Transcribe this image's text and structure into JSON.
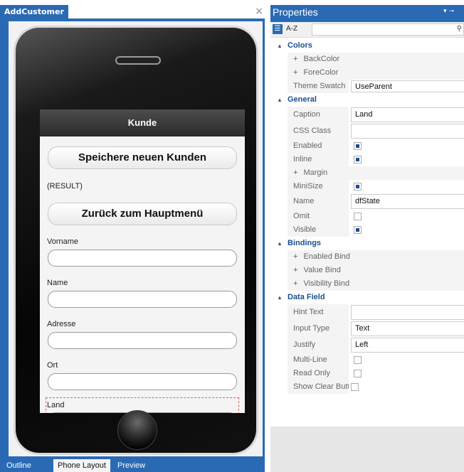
{
  "document_tab": {
    "title": "AddCustomer",
    "close": "×"
  },
  "phone_screen": {
    "header_title": "Kunde",
    "save_button": "Speichere neuen Kunden",
    "result_label": "(RESULT)",
    "back_button": "Zurück zum Hauptmenü",
    "fields": {
      "vorname": "Vorname",
      "name": "Name",
      "adresse": "Adresse",
      "ort": "Ort",
      "land": "Land"
    }
  },
  "bottom_tabs": [
    "Outline",
    "Phone Layout",
    "Preview"
  ],
  "properties": {
    "title": "Properties",
    "pin": "▾ ⊸",
    "sort_az": "A-Z",
    "categories": {
      "colors": {
        "label": "Colors",
        "rows": {
          "backcolor": "BackColor",
          "forecolor": "ForeColor",
          "theme_swatch": "Theme Swatch",
          "theme_swatch_value": "UseParent"
        }
      },
      "general": {
        "label": "General",
        "rows": {
          "caption": "Caption",
          "caption_value": "Land",
          "css_class": "CSS Class",
          "enabled": "Enabled",
          "inline": "Inline",
          "margin": "Margin",
          "minisize": "MiniSize",
          "name": "Name",
          "name_value": "dfState",
          "omit": "Omit",
          "visible": "Visible"
        },
        "checks": {
          "enabled": true,
          "inline": true,
          "minisize": true,
          "omit": false,
          "visible": true
        }
      },
      "bindings": {
        "label": "Bindings",
        "rows": {
          "enabled_bind": "Enabled Bind",
          "value_bind": "Value Bind",
          "visibility_bind": "Visibility Bind"
        }
      },
      "data_field": {
        "label": "Data Field",
        "rows": {
          "hint_text": "Hint Text",
          "input_type": "Input Type",
          "input_type_value": "Text",
          "justify": "Justify",
          "justify_value": "Left",
          "multi_line": "Multi-Line",
          "read_only": "Read Only",
          "show_clear": "Show Clear Butto"
        },
        "checks": {
          "multi_line": false,
          "read_only": false,
          "show_clear": false
        }
      }
    }
  },
  "colors": {
    "accent": "#2a6ab4",
    "category_text": "#1a4f8f"
  }
}
